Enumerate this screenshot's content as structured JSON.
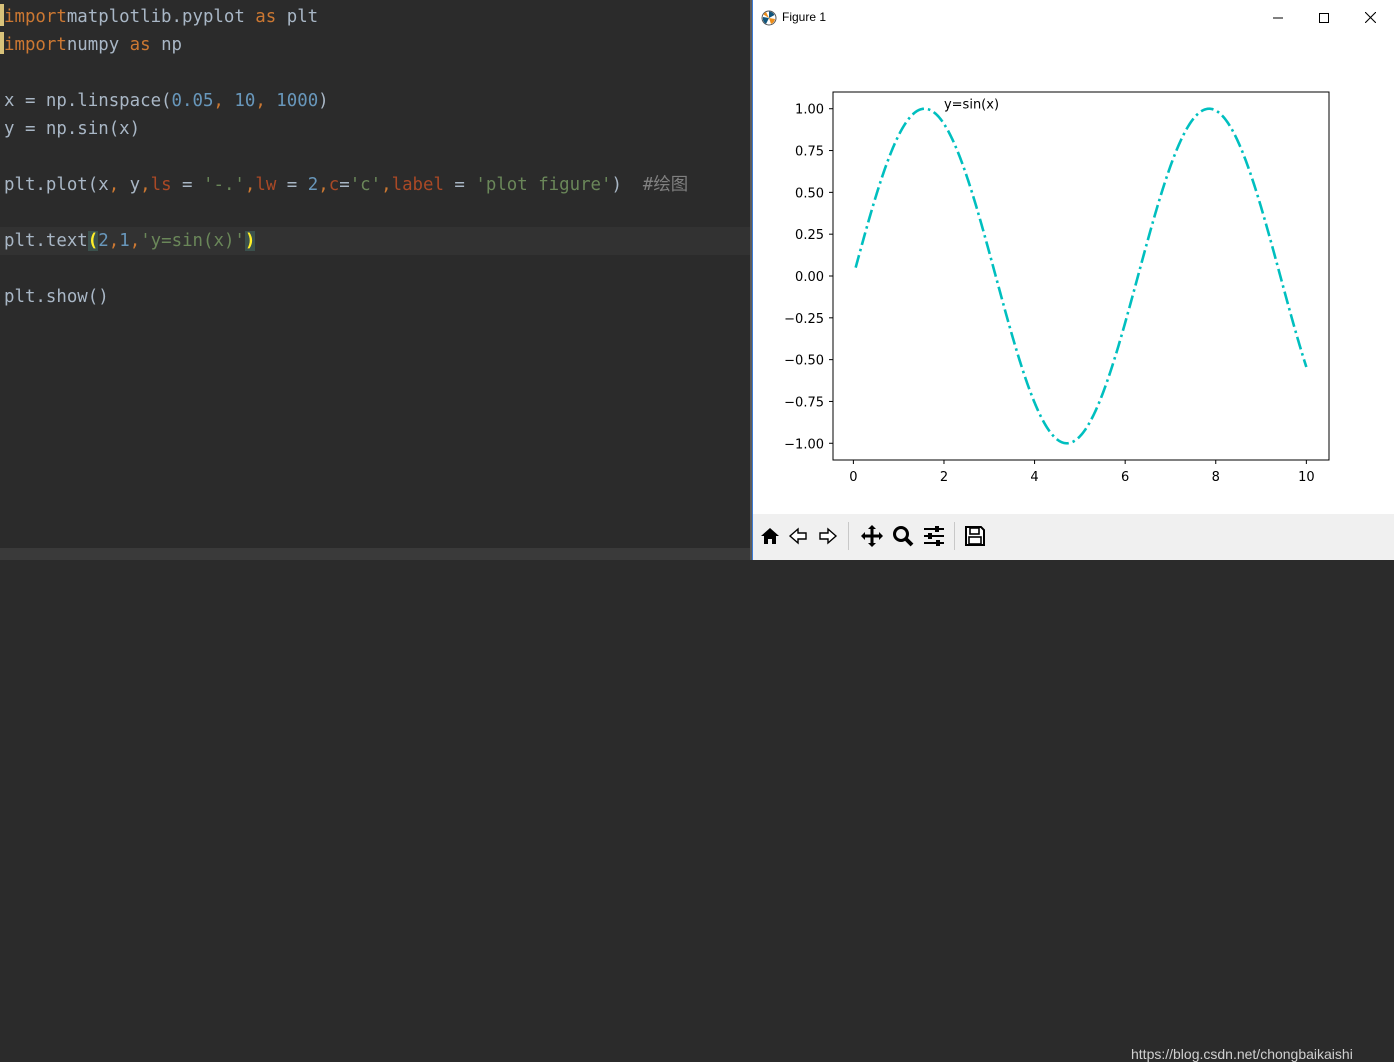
{
  "editor": {
    "lines": [
      {
        "tokens": [
          [
            "kw",
            "import"
          ],
          [
            "",
            "matplotlib.pyplot "
          ],
          [
            "kw",
            "as"
          ],
          [
            "",
            " plt"
          ]
        ]
      },
      {
        "tokens": [
          [
            "kw",
            "import"
          ],
          [
            "",
            "numpy "
          ],
          [
            "kw",
            "as"
          ],
          [
            "",
            " np"
          ]
        ]
      },
      {
        "tokens": []
      },
      {
        "tokens": [
          [
            "",
            "x = np.linspace("
          ],
          [
            "num",
            "0.05"
          ],
          [
            "kw",
            ", "
          ],
          [
            "num",
            "10"
          ],
          [
            "kw",
            ", "
          ],
          [
            "num",
            "1000"
          ],
          [
            "",
            ")"
          ]
        ]
      },
      {
        "tokens": [
          [
            "",
            "y = np.sin(x)"
          ]
        ]
      },
      {
        "tokens": []
      },
      {
        "tokens": [
          [
            "",
            "plt.plot(x"
          ],
          [
            "kw",
            ","
          ],
          [
            "",
            " y"
          ],
          [
            "kw",
            ","
          ],
          [
            "param",
            "ls"
          ],
          [
            "",
            " = "
          ],
          [
            "str",
            "'-.'"
          ],
          [
            "kw",
            ","
          ],
          [
            "param",
            "lw"
          ],
          [
            "",
            " = "
          ],
          [
            "num",
            "2"
          ],
          [
            "kw",
            ","
          ],
          [
            "param",
            "c"
          ],
          [
            "",
            "="
          ],
          [
            "str",
            "'c'"
          ],
          [
            "kw",
            ","
          ],
          [
            "param",
            "label"
          ],
          [
            "",
            " = "
          ],
          [
            "str",
            "'plot figure'"
          ],
          [
            "",
            ")  "
          ],
          [
            "cmt",
            "#绘图"
          ]
        ]
      },
      {
        "tokens": []
      },
      {
        "tokens": [
          [
            "",
            "plt.text"
          ],
          [
            "paren-hl",
            "("
          ],
          [
            "num",
            "2"
          ],
          [
            "kw",
            ","
          ],
          [
            "num",
            "1"
          ],
          [
            "kw",
            ","
          ],
          [
            "str",
            "'y=sin(x)'"
          ],
          [
            "paren-hl",
            ")"
          ]
        ]
      },
      {
        "tokens": []
      },
      {
        "tokens": [
          [
            "",
            "plt.show()"
          ]
        ]
      }
    ]
  },
  "figure_window": {
    "title": "Figure 1",
    "minimize_label": "minimize",
    "maximize_label": "maximize",
    "close_label": "close"
  },
  "toolbar": {
    "buttons": [
      "home-icon",
      "back-icon",
      "forward-icon",
      "pan-icon",
      "zoom-icon",
      "configure-subplots-icon",
      "save-icon"
    ]
  },
  "watermark": "https://blog.csdn.net/chongbaikaishi",
  "chart_data": {
    "type": "line",
    "title": "",
    "xlabel": "",
    "ylabel": "",
    "xlim": [
      -0.45,
      10.5
    ],
    "ylim": [
      -1.1,
      1.1
    ],
    "x_ticks": [
      0,
      2,
      4,
      6,
      8,
      10
    ],
    "x_tick_labels": [
      "0",
      "2",
      "4",
      "6",
      "8",
      "10"
    ],
    "y_ticks": [
      1.0,
      0.75,
      0.5,
      0.25,
      0.0,
      -0.25,
      -0.5,
      -0.75,
      -1.0
    ],
    "y_tick_labels": [
      "1.00",
      "0.75",
      "0.50",
      "0.25",
      "0.00",
      "−0.25",
      "−0.50",
      "−0.75",
      "−1.00"
    ],
    "series": [
      {
        "function": "sin",
        "x_start": 0.05,
        "x_end": 10,
        "n_points": 1000,
        "color": "#00bfbf",
        "line_style": "dash-dot",
        "line_width": 2
      }
    ],
    "annotations": [
      {
        "text": "y=sin(x)",
        "x": 2,
        "y": 1
      }
    ],
    "grid": false,
    "legend": null
  }
}
